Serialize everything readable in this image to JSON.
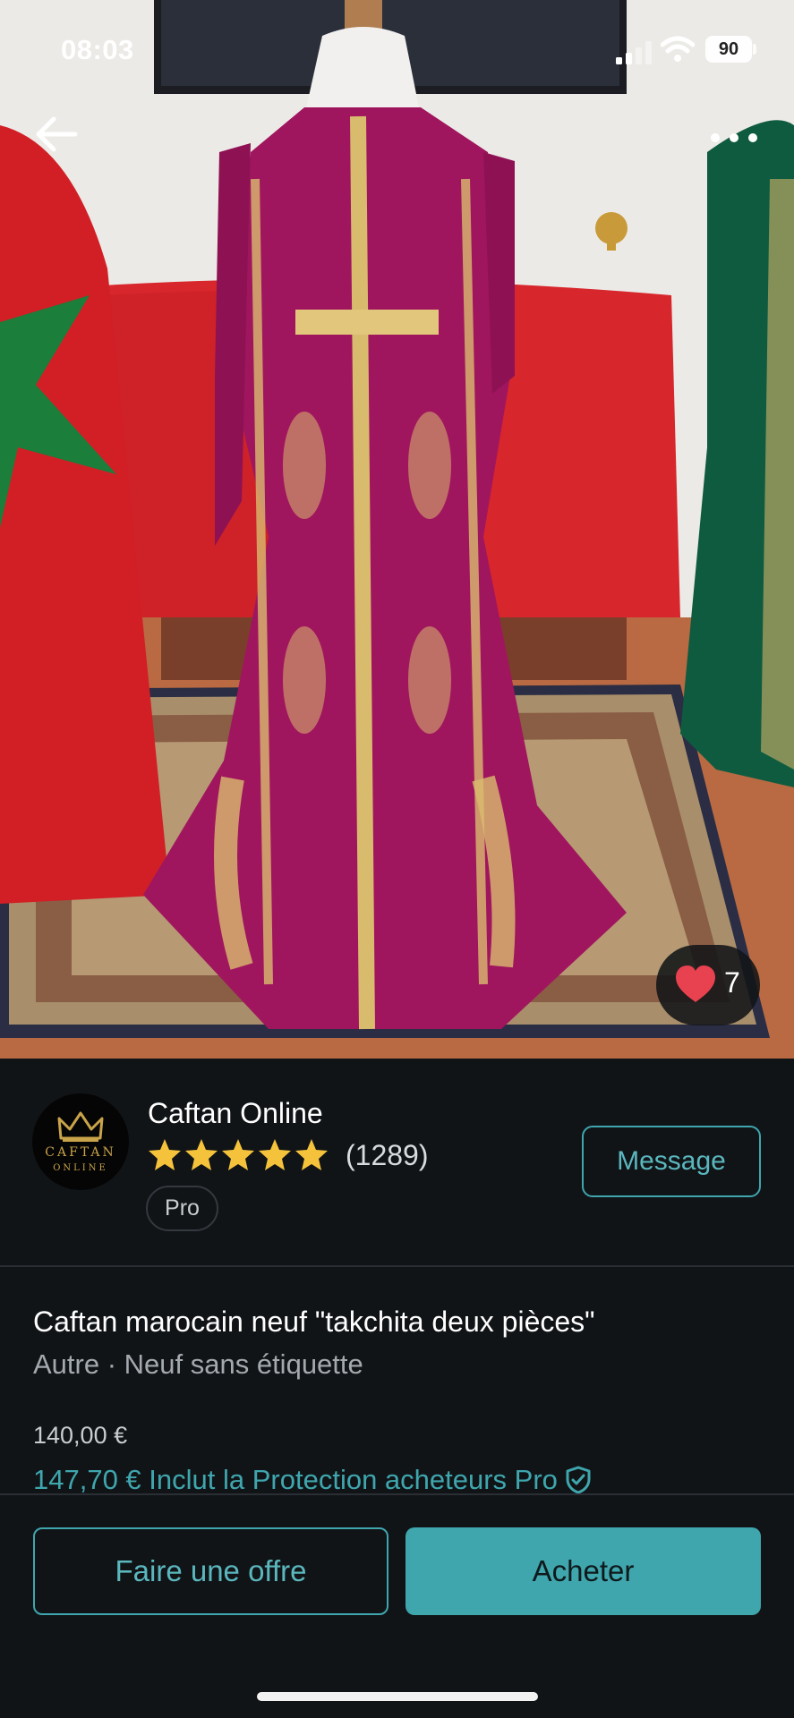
{
  "status_bar": {
    "time": "08:03",
    "battery": "90"
  },
  "listing": {
    "likes": "7",
    "title": "Caftan marocain neuf \"takchita deux pièces\"",
    "subtitle": "Autre · Neuf sans étiquette",
    "price": "140,00 €",
    "price_with_protection": "147,70 € Inclut la Protection acheteurs Pro"
  },
  "seller": {
    "name": "Caftan Online",
    "logo_text_1": "CAFTAN",
    "logo_text_2": "ONLINE",
    "rating": 5,
    "reviews": "(1289)",
    "badge": "Pro",
    "message_label": "Message"
  },
  "actions": {
    "offer_label": "Faire une offre",
    "buy_label": "Acheter"
  },
  "colors": {
    "accent": "#3FA6AE",
    "background": "#111417",
    "star": "#F5C33B",
    "heart": "#E8414F"
  },
  "icons": [
    "back-arrow-icon",
    "more-icon",
    "heart-icon",
    "star-icon",
    "shield-check-icon",
    "signal-icon",
    "wifi-icon",
    "battery-icon"
  ]
}
